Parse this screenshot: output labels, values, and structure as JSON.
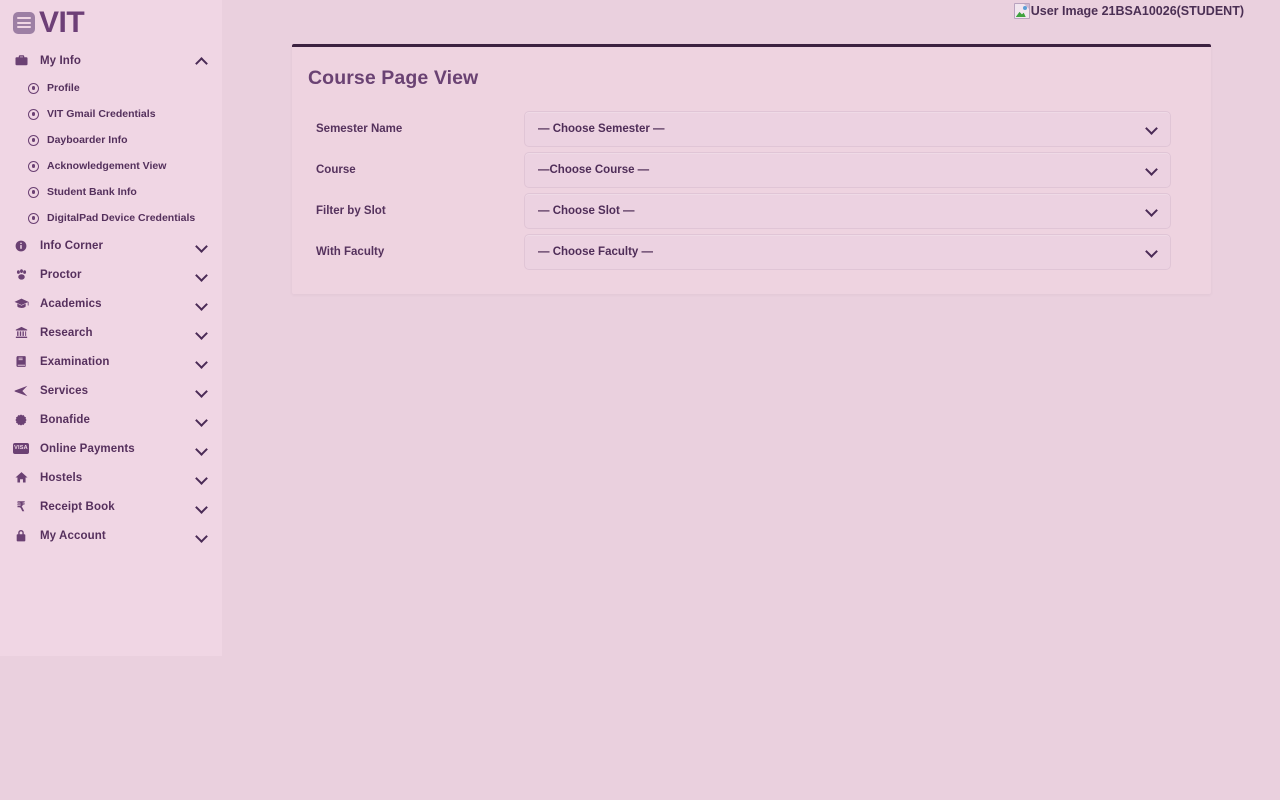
{
  "brand": {
    "logo_icon": "list-menu-icon",
    "logo_text": "VIT"
  },
  "header": {
    "user_badge_text": "User Image 21BSA10026(STUDENT)",
    "user_image_icon": "broken-image-icon"
  },
  "sidebar": {
    "items": [
      {
        "label": "My Info",
        "icon": "briefcase-icon",
        "chevron": "chevron-up-icon",
        "expanded": true
      },
      {
        "label": "Info Corner",
        "icon": "info-circle-icon",
        "chevron": "chevron-down-icon",
        "expanded": false
      },
      {
        "label": "Proctor",
        "icon": "paw-icon",
        "chevron": "chevron-down-icon",
        "expanded": false
      },
      {
        "label": "Academics",
        "icon": "graduation-cap-icon",
        "chevron": "chevron-down-icon",
        "expanded": false
      },
      {
        "label": "Research",
        "icon": "bank-icon",
        "chevron": "chevron-down-icon",
        "expanded": false
      },
      {
        "label": "Examination",
        "icon": "book-icon",
        "chevron": "chevron-down-icon",
        "expanded": false
      },
      {
        "label": "Services",
        "icon": "paper-plane-icon",
        "chevron": "chevron-down-icon",
        "expanded": false
      },
      {
        "label": "Bonafide",
        "icon": "certificate-icon",
        "chevron": "chevron-down-icon",
        "expanded": false
      },
      {
        "label": "Online Payments",
        "icon": "visa-card-icon",
        "chevron": "chevron-down-icon",
        "expanded": false
      },
      {
        "label": "Hostels",
        "icon": "home-icon",
        "chevron": "chevron-down-icon",
        "expanded": false
      },
      {
        "label": "Receipt Book",
        "icon": "rupee-icon",
        "chevron": "chevron-down-icon",
        "expanded": false
      },
      {
        "label": "My Account",
        "icon": "lock-icon",
        "chevron": "chevron-down-icon",
        "expanded": false
      }
    ],
    "my_info_subitems": [
      {
        "label": "Profile",
        "icon": "dot-circle-icon"
      },
      {
        "label": "VIT Gmail Credentials",
        "icon": "dot-circle-icon"
      },
      {
        "label": "Dayboarder Info",
        "icon": "dot-circle-icon"
      },
      {
        "label": "Acknowledgement View",
        "icon": "dot-circle-icon"
      },
      {
        "label": "Student Bank Info",
        "icon": "dot-circle-icon"
      },
      {
        "label": "DigitalPad Device Credentials",
        "icon": "dot-circle-icon"
      }
    ]
  },
  "main": {
    "card_title": "Course Page View",
    "form_rows": [
      {
        "label": "Semester Name",
        "value": "— Choose Semester —"
      },
      {
        "label": "Course",
        "value": "—Choose Course —"
      },
      {
        "label": "Filter by Slot",
        "value": "— Choose Slot —"
      },
      {
        "label": "With Faculty",
        "value": "— Choose Faculty —"
      }
    ]
  },
  "colors": {
    "page_background": "#ead0de",
    "sidebar_background": "#f0d6e4",
    "card_background": "#eed3e0",
    "card_top_border": "#3c2140",
    "brand_purple": "#6d3f77",
    "text_purple": "#55325d"
  }
}
